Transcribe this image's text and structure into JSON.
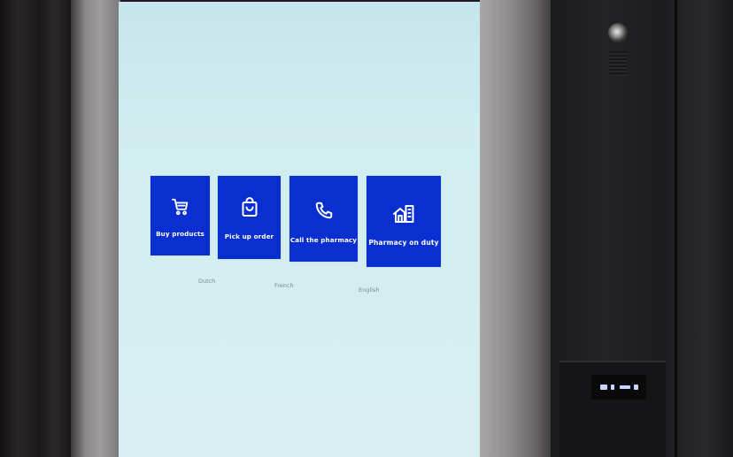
{
  "kiosk": {
    "tiles": [
      {
        "label": "Buy products",
        "icon": "cart-icon"
      },
      {
        "label": "Pick up order",
        "icon": "shopping-bag-icon"
      },
      {
        "label": "Call the pharmacy",
        "icon": "phone-icon"
      },
      {
        "label": "Pharmacy on duty",
        "icon": "building-icon"
      }
    ],
    "languages": [
      "Dutch",
      "French",
      "English"
    ],
    "colors": {
      "tile_background": "#0a2fd1",
      "tile_text": "#ffffff",
      "screen_background": "#cfecef",
      "language_text": "#6e8a97"
    }
  }
}
